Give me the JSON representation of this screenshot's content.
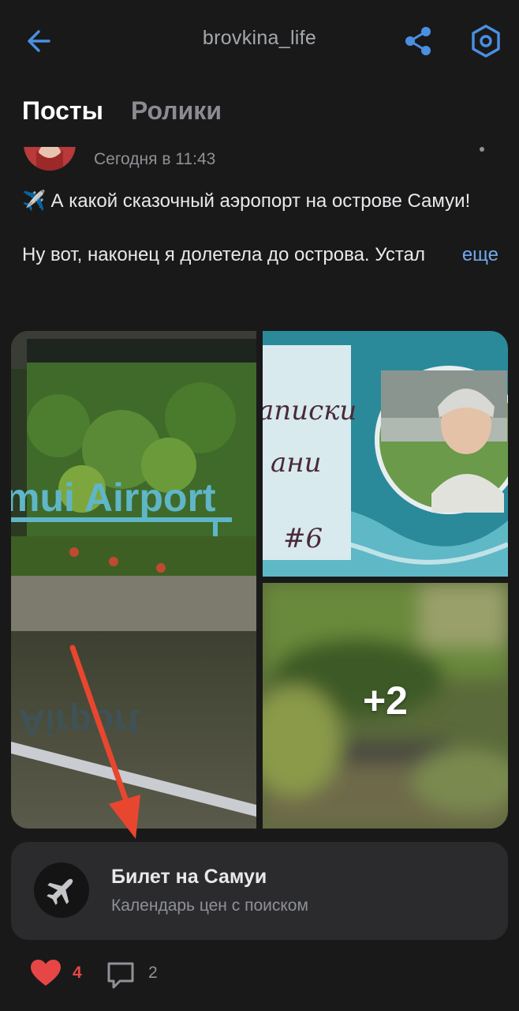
{
  "header": {
    "title": "brovkina_life",
    "back_icon": "arrow-left-icon",
    "share_icon": "share-icon",
    "settings_icon": "settings-icon",
    "accent_color": "#4a90e2"
  },
  "tabs": [
    {
      "label": "Посты",
      "active": true
    },
    {
      "label": "Ролики",
      "active": false
    }
  ],
  "post": {
    "timestamp": "Сегодня в 11:43",
    "text_line1_emoji": "✈️",
    "text_line1": " А какой сказочный аэропорт на острове Самуи!",
    "text_line2": "Ну вот, наконец я долетела до острова. Устал",
    "more_label": "еще",
    "photos": {
      "main_caption": "mui Airport",
      "tr_caption_1": "аписки",
      "tr_caption_2": "ани",
      "tr_caption_3": "#6",
      "extra_count": "+2"
    },
    "ticket": {
      "title": "Билет на Самуи",
      "subtitle": "Календарь цен с поиском",
      "icon": "airplane-icon"
    },
    "likes": "4",
    "comments": "2",
    "like_color": "#e64646"
  }
}
